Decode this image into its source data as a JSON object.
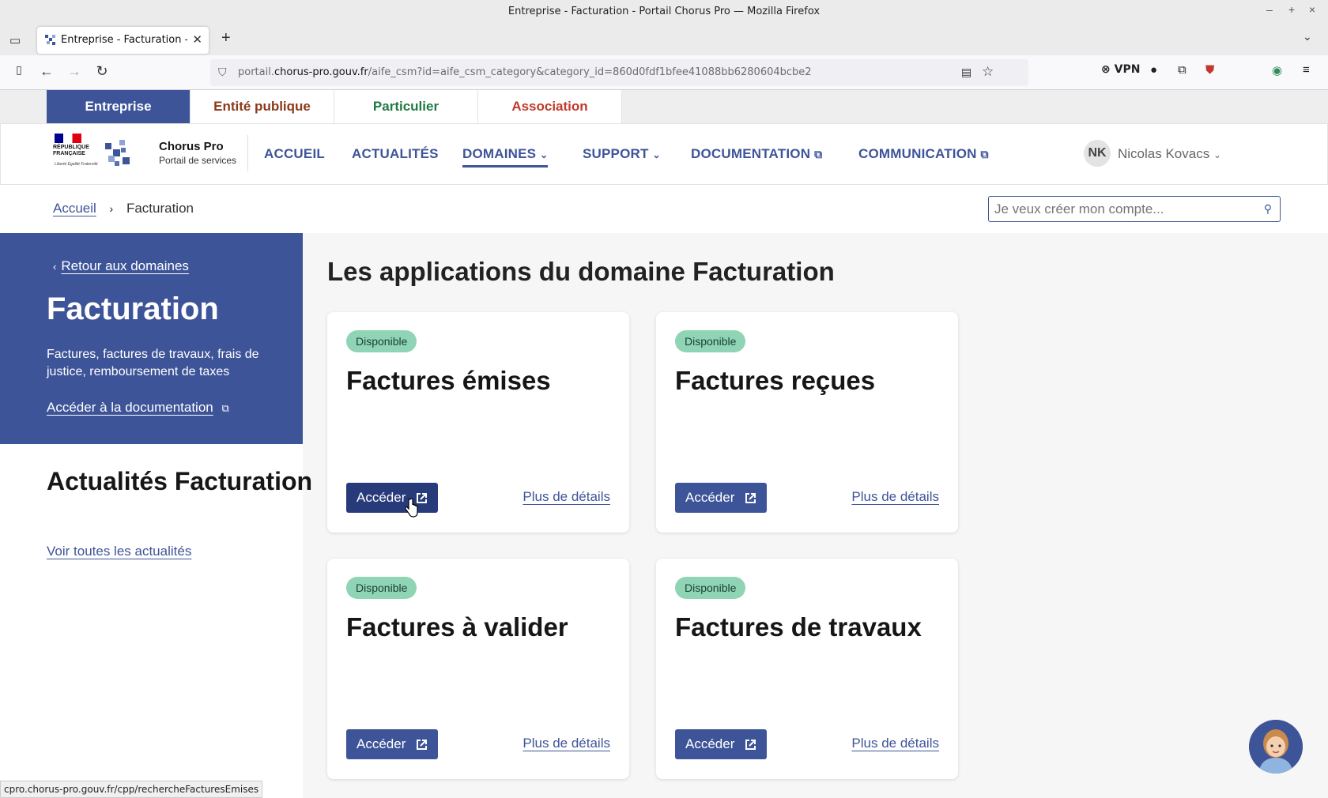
{
  "window": {
    "title": "Entreprise - Facturation - Portail Chorus Pro — Mozilla Firefox"
  },
  "tab": {
    "title": "Entreprise - Facturation - Po"
  },
  "urlbar": {
    "url_host_prefix": "portail.",
    "url_host": "chorus-pro.gouv.fr",
    "url_path": "/aife_csm?id=aife_csm_category&category_id=860d0fdf1bfee41088bb6280604bcbe2"
  },
  "toolbar": {
    "vpn_label": "VPN"
  },
  "user_tabs": [
    {
      "label": "Entreprise",
      "color": "#ffffff",
      "bg": "#3e5498"
    },
    {
      "label": "Entité publique",
      "color": "#8b3a1a",
      "bg": "#ffffff"
    },
    {
      "label": "Particulier",
      "color": "#1f7a45",
      "bg": "#ffffff"
    },
    {
      "label": "Association",
      "color": "#c0392b",
      "bg": "#ffffff"
    }
  ],
  "brand": {
    "republic": "RÉPUBLIQUE FRANÇAISE",
    "devise": "Liberté Égalité Fraternité",
    "name": "Chorus Pro",
    "subtitle": "Portail de services"
  },
  "nav": {
    "accueil": "ACCUEIL",
    "actualites": "ACTUALITÉS",
    "domaines": "DOMAINES",
    "support": "SUPPORT",
    "documentation": "DOCUMENTATION",
    "communication": "COMMUNICATION"
  },
  "user": {
    "initials": "NK",
    "name": "Nicolas Kovacs"
  },
  "breadcrumb": {
    "home": "Accueil",
    "current": "Facturation"
  },
  "search": {
    "placeholder": "Je veux créer mon compte..."
  },
  "side": {
    "back": "Retour aux domaines",
    "title": "Facturation",
    "description": "Factures, factures de travaux, frais de justice, remboursement de taxes",
    "doc_link": "Accéder à la documentation",
    "news_title": "Actualités Facturation",
    "news_link": "Voir toutes les actualités"
  },
  "main": {
    "title": "Les applications du domaine Facturation"
  },
  "cards": [
    {
      "badge": "Disponible",
      "title": "Factures émises",
      "button": "Accéder",
      "more": "Plus de détails"
    },
    {
      "badge": "Disponible",
      "title": "Factures reçues",
      "button": "Accéder",
      "more": "Plus de détails"
    },
    {
      "badge": "Disponible",
      "title": "Factures à valider",
      "button": "Accéder",
      "more": "Plus de détails"
    },
    {
      "badge": "Disponible",
      "title": "Factures de travaux",
      "button": "Accéder",
      "more": "Plus de détails"
    }
  ],
  "status": {
    "link_preview": "cpro.chorus-pro.gouv.fr/cpp/rechercheFacturesEmises"
  },
  "colors": {
    "primary": "#3e5498",
    "primary_dark": "#273a7a",
    "badge": "#8fd4b4"
  }
}
